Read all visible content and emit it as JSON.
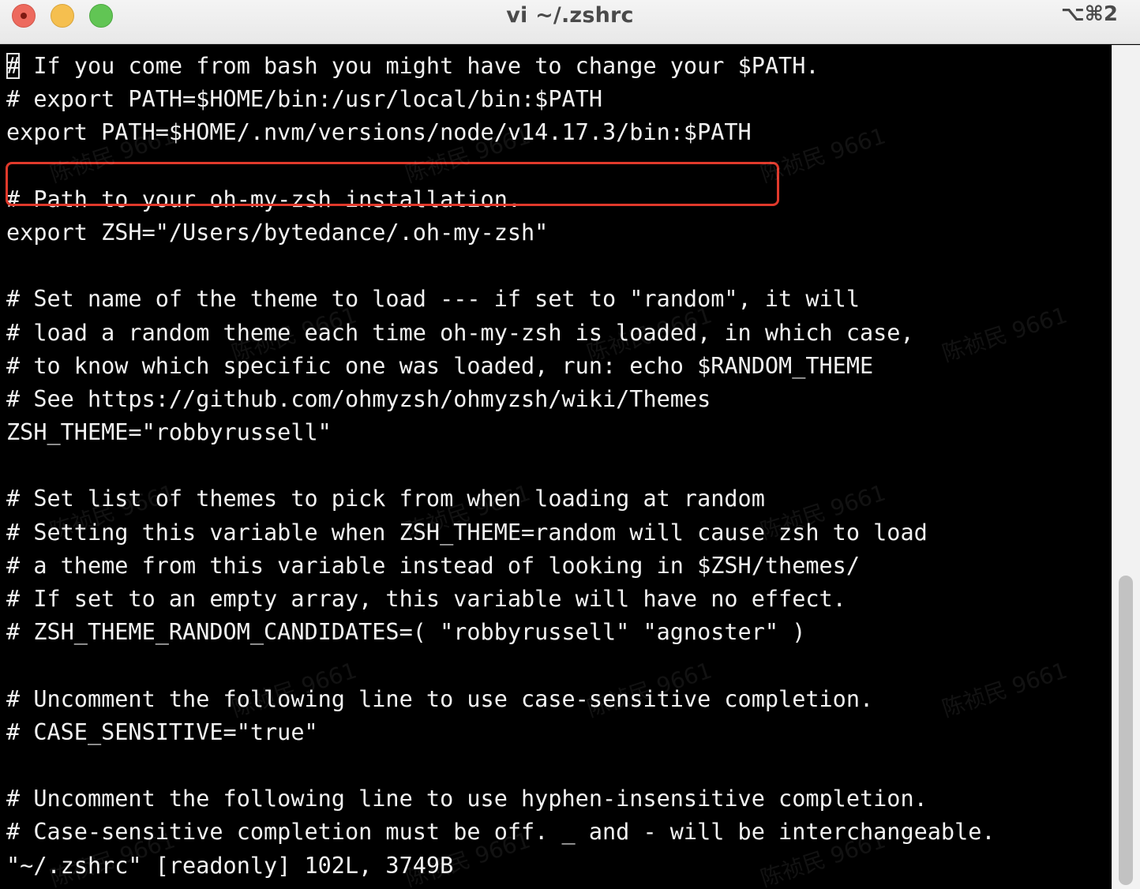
{
  "window": {
    "title": "vi ~/.zshrc",
    "shortcut": "⌥⌘2"
  },
  "editor": {
    "lines": [
      "# If you come from bash you might have to change your $PATH.",
      "# export PATH=$HOME/bin:/usr/local/bin:$PATH",
      "export PATH=$HOME/.nvm/versions/node/v14.17.3/bin:$PATH",
      "",
      "# Path to your oh-my-zsh installation.",
      "export ZSH=\"/Users/bytedance/.oh-my-zsh\"",
      "",
      "# Set name of the theme to load --- if set to \"random\", it will",
      "# load a random theme each time oh-my-zsh is loaded, in which case,",
      "# to know which specific one was loaded, run: echo $RANDOM_THEME",
      "# See https://github.com/ohmyzsh/ohmyzsh/wiki/Themes",
      "ZSH_THEME=\"robbyrussell\"",
      "",
      "# Set list of themes to pick from when loading at random",
      "# Setting this variable when ZSH_THEME=random will cause zsh to load",
      "# a theme from this variable instead of looking in $ZSH/themes/",
      "# If set to an empty array, this variable will have no effect.",
      "# ZSH_THEME_RANDOM_CANDIDATES=( \"robbyrussell\" \"agnoster\" )",
      "",
      "# Uncomment the following line to use case-sensitive completion.",
      "# CASE_SENSITIVE=\"true\"",
      "",
      "# Uncomment the following line to use hyphen-insensitive completion.",
      "# Case-sensitive completion must be off. _ and - will be interchangeable."
    ],
    "highlighted_line": 2,
    "status_line": "\"~/.zshrc\" [readonly] 102L, 3749B"
  },
  "watermark": {
    "text": "陈祯民 9661"
  },
  "colors": {
    "background": "#000000",
    "text": "#f2f2f2",
    "highlight_border": "#e0392b",
    "close": "#ed6a5e",
    "minimize": "#f5bf4f",
    "maximize": "#61c554"
  }
}
